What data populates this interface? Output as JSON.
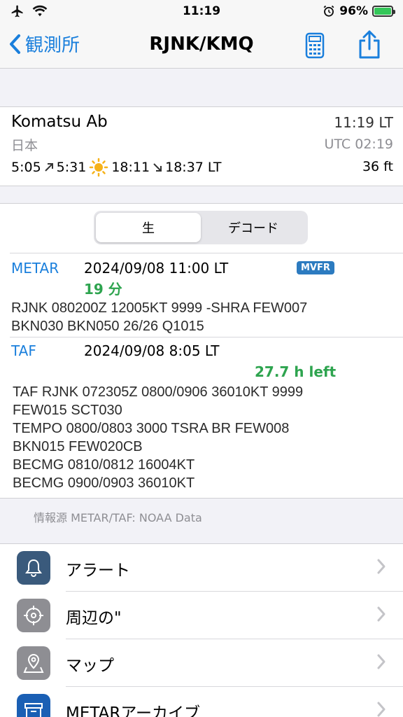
{
  "status": {
    "time": "11:19",
    "battery": "96%"
  },
  "nav": {
    "back_label": "観測所",
    "title": "RJNK/KMQ"
  },
  "station": {
    "name": "Komatsu Ab",
    "local_time": "11:19 LT",
    "country": "日本",
    "utc_time": "UTC 02:19",
    "dawn": "5:05",
    "sunrise": "5:31",
    "sunset": "18:11",
    "dusk": "18:37 LT",
    "elevation": "36 ft"
  },
  "segment": {
    "raw": "生",
    "decoded": "デコード"
  },
  "metar": {
    "label": "METAR",
    "date": "2024/09/08 11:00 LT",
    "age": "19 分",
    "category": "MVFR",
    "lines": [
      "RJNK 080200Z 12005KT 9999 -SHRA FEW007",
      "BKN030 BKN050 26/26 Q1015"
    ]
  },
  "taf": {
    "label": "TAF",
    "date": "2024/09/08 8:05 LT",
    "remaining": "27.7 h left",
    "lines": [
      "TAF RJNK 072305Z 0800/0906 36010KT 9999",
      "FEW015 SCT030",
      "TEMPO 0800/0803 3000 TSRA BR FEW008",
      "BKN015 FEW020CB",
      "BECMG 0810/0812 16004KT",
      "BECMG 0900/0903 36010KT"
    ]
  },
  "source": "情報源 METAR/TAF: NOAA Data",
  "menu": [
    {
      "label": "アラート",
      "icon": "bell-icon",
      "color": "#3a5a7c"
    },
    {
      "label": "周辺の\"",
      "icon": "crosshair-icon",
      "color": "#8e8e93"
    },
    {
      "label": "マップ",
      "icon": "map-pin-icon",
      "color": "#8e8e93"
    },
    {
      "label": "METARアーカイブ",
      "icon": "archive-icon",
      "color": "#1a5fb4"
    }
  ]
}
